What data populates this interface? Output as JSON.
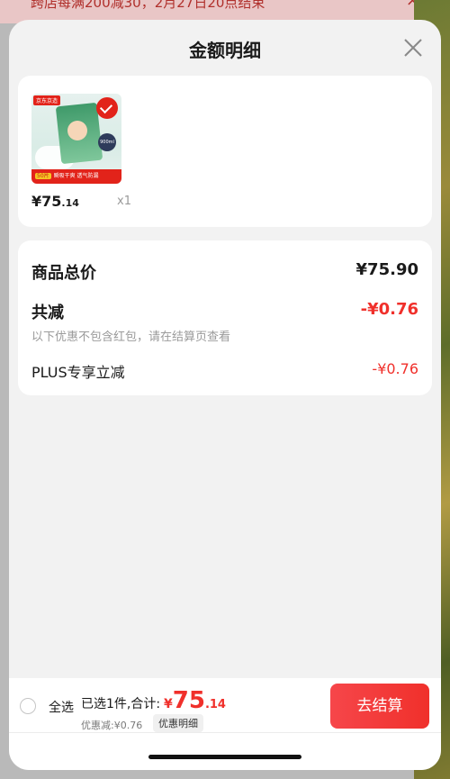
{
  "background": {
    "banner_text": "跨店每满200减30，2月27日20点结束",
    "banner_close": "×"
  },
  "sheet": {
    "title": "金额明细"
  },
  "product": {
    "brand_tag": "京东京造",
    "check": "✓",
    "badge": "900ml",
    "strip_tag": "50片",
    "strip_text": "瞬吸干爽 透气防漏",
    "price_prefix": "¥75",
    "price_cents": ".14",
    "quantity": "x1"
  },
  "summary": {
    "total_label": "商品总价",
    "total_value": "¥75.90",
    "reduce_label": "共减",
    "reduce_value": "-¥0.76",
    "reduce_note": "以下优惠不包含红包，请在结算页查看",
    "plus_label": "PLUS专享立减",
    "plus_value": "-¥0.76"
  },
  "bottom": {
    "select_all": "全选",
    "selected_text": "已选1件,合计:",
    "price_symbol": "¥",
    "price_int": "75",
    "price_dec": ".14",
    "discount_text": "优惠减:¥0.76",
    "detail_chip": "优惠明细",
    "checkout": "去结算"
  },
  "colors": {
    "accent_red": "#f0302b",
    "sheet_bg": "#f2f2f2",
    "card_bg": "#ffffff"
  }
}
